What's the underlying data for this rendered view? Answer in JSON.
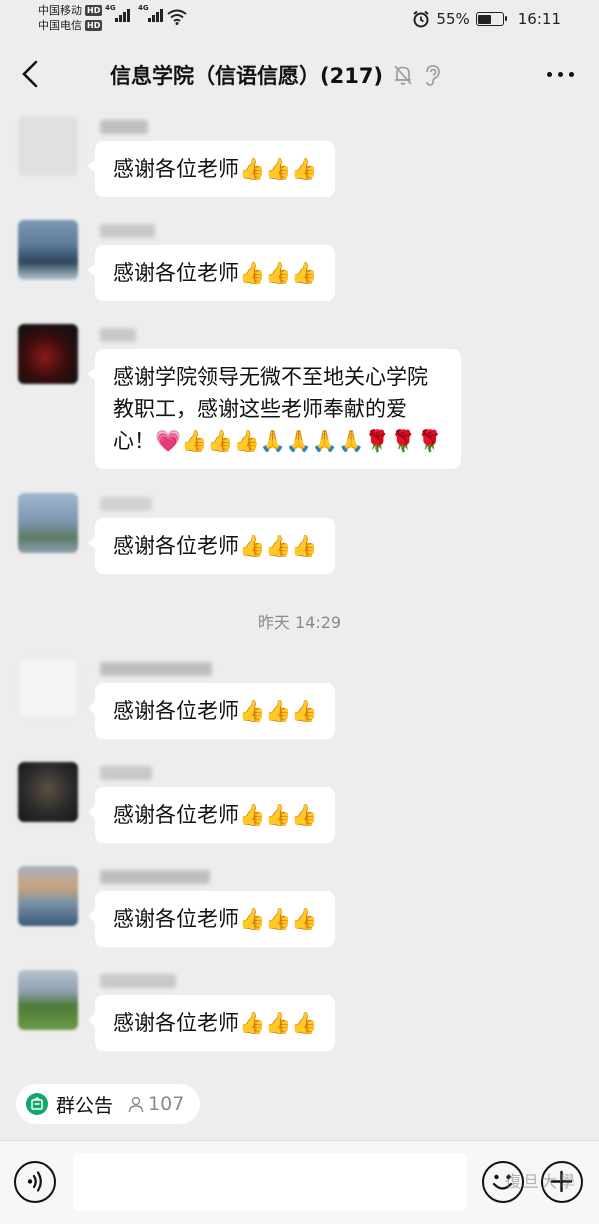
{
  "status_bar": {
    "carrier_1": "中国移动",
    "carrier_2": "中国电信",
    "hd_1": "HD",
    "hd_2": "HD",
    "network_1": "4G",
    "network_2": "4G",
    "battery_percent": "55%",
    "battery_level": 0.55,
    "time": "16:11",
    "icons": [
      "signal-icon",
      "wifi-icon",
      "alarm-icon",
      "battery-icon"
    ]
  },
  "header": {
    "title": "信息学院（信语信愿）(217)",
    "icons": [
      "back-icon",
      "mute-bell-icon",
      "ear-icon",
      "more-icon"
    ]
  },
  "messages": [
    {
      "text": "感谢各位老师👍👍👍",
      "avatar_color": "#d8d8d8"
    },
    {
      "text": "感谢各位老师👍👍👍",
      "avatar_color": "#5a7690"
    },
    {
      "text": "感谢学院领导无微不至地关心学院\n教职工，感谢这些老师奉献的爱\n心！💗👍👍👍🙏🙏🙏🙏🌹🌹🌹",
      "avatar_color": "#3a1010"
    },
    {
      "text": "感谢各位老师👍👍👍",
      "avatar_color": "#8aa0b8"
    },
    {
      "text": "感谢各位老师👍👍👍",
      "avatar_color": "#f2f2f2"
    },
    {
      "text": "感谢各位老师👍👍👍",
      "avatar_color": "#2a2a2a"
    },
    {
      "text": "感谢各位老师👍👍👍",
      "avatar_color": "#6b86a0"
    },
    {
      "text": "感谢各位老师👍👍👍",
      "avatar_color": "#4f7a3a"
    }
  ],
  "timestamp": "昨天 14:29",
  "announcement": {
    "label": "群公告",
    "member_count": "107",
    "icons": [
      "notice-icon",
      "person-icon"
    ]
  },
  "input_bar": {
    "placeholder": "",
    "icons": [
      "voice-icon",
      "emoji-icon",
      "plus-icon"
    ]
  },
  "watermark": "復旦大學",
  "colors": {
    "background": "#ededed",
    "bubble": "#ffffff",
    "accent_green": "#11a869"
  }
}
